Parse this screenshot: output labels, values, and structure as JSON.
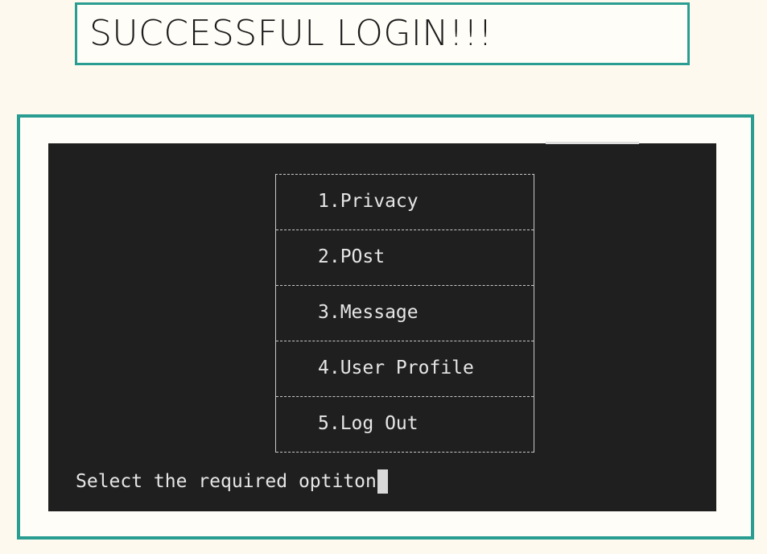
{
  "banner": {
    "title": "SUCCESSFUL LOGIN!!!"
  },
  "terminal": {
    "menu_items": [
      {
        "label": "1.Privacy"
      },
      {
        "label": "2.POst"
      },
      {
        "label": "3.Message"
      },
      {
        "label": "4.User Profile"
      },
      {
        "label": "5.Log Out"
      }
    ],
    "prompt": "Select the required optiton"
  },
  "colors": {
    "accent": "#2a9d92",
    "page_background": "#fdf9ee",
    "terminal_background": "#1f1f1f",
    "terminal_text": "#e6e6e6"
  }
}
